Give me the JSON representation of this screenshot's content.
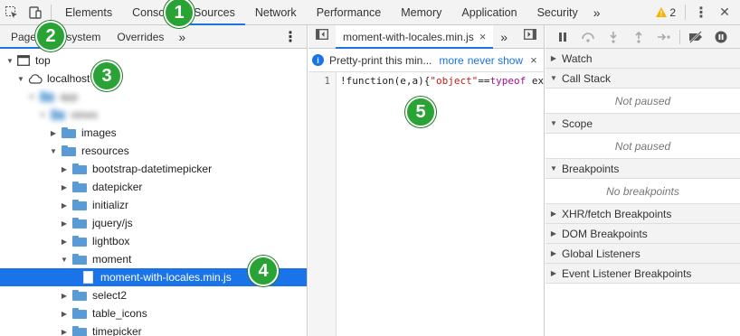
{
  "toolbar": {
    "tabs": [
      "Elements",
      "Console",
      "Sources",
      "Network",
      "Performance",
      "Memory",
      "Application",
      "Security"
    ],
    "more": "»",
    "warning_count": "2",
    "menu": "⋮",
    "close": "✕"
  },
  "navigator": {
    "tabs": [
      "Page",
      "Filesystem",
      "Overrides"
    ],
    "more": "»",
    "menu": "⋮",
    "tree": {
      "top": "top",
      "host": "localhost",
      "blur1": "app",
      "blur2": "views",
      "images": "images",
      "resources": "resources",
      "children": [
        "bootstrap-datetimepicker",
        "datepicker",
        "initializr",
        "jquery/js",
        "lightbox"
      ],
      "moment": "moment",
      "file": "moment-with-locales.min.js",
      "after": [
        "select2",
        "table_icons",
        "timepicker"
      ]
    }
  },
  "editor": {
    "tab_name": "moment-with-locales.min.js",
    "close": "×",
    "more": "»",
    "info_text": "Pretty-print this min...",
    "info_link": "more",
    "info_link2": "never show",
    "info_close": "×",
    "line_number": "1",
    "code_start": "!function(e,a){",
    "code_str": "\"object\"",
    "code_op": "==",
    "code_kw": "typeof",
    "code_end": " ex"
  },
  "debugger": {
    "sections": {
      "watch": "Watch",
      "callstack": "Call Stack",
      "callstack_empty": "Not paused",
      "scope": "Scope",
      "scope_empty": "Not paused",
      "breakpoints": "Breakpoints",
      "breakpoints_empty": "No breakpoints",
      "xhr": "XHR/fetch Breakpoints",
      "dom": "DOM Breakpoints",
      "global": "Global Listeners",
      "event": "Event Listener Breakpoints"
    }
  },
  "badges": [
    "1",
    "2",
    "3",
    "4",
    "5"
  ],
  "colors": {
    "accent": "#1a73e8",
    "badge": "#2aa335",
    "folder": "#5a9bd5"
  }
}
